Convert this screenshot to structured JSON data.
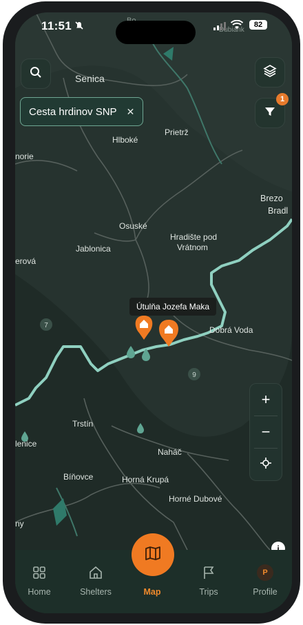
{
  "status_bar": {
    "time": "11:51",
    "battery": "82"
  },
  "filters": {
    "active_chip": "Cesta hrdinov SNP",
    "filter_count": "1"
  },
  "tooltip": "Útulňa Jozefa Maka",
  "map_labels": [
    {
      "text": "Senica"
    },
    {
      "text": "Prietrž"
    },
    {
      "text": "Hlboké"
    },
    {
      "text": "norie"
    },
    {
      "text": "Brezo"
    },
    {
      "text": "Bradl"
    },
    {
      "text": "Osuské"
    },
    {
      "text": "Hradište pod"
    },
    {
      "text": "Vrátnom"
    },
    {
      "text": "Jablonica"
    },
    {
      "text": "erová"
    },
    {
      "text": "Dobrá Voda"
    },
    {
      "text": "Trstín"
    },
    {
      "text": "lenice"
    },
    {
      "text": "Naháč"
    },
    {
      "text": "Bíňovce"
    },
    {
      "text": "Horná Krupá"
    },
    {
      "text": "Horné Dubové"
    },
    {
      "text": "ny"
    },
    {
      "text": "Dubiank"
    },
    {
      "text": "Bo"
    }
  ],
  "route_markers": [
    "7",
    "9"
  ],
  "zoom": {
    "in": "+",
    "out": "−"
  },
  "nav": {
    "home": "Home",
    "shelters": "Shelters",
    "map": "Map",
    "trips": "Trips",
    "profile": "Profile",
    "profile_initial": "P"
  },
  "colors": {
    "accent": "#f07a22",
    "route": "#8fd0c0",
    "map_bg": "#24302c"
  }
}
